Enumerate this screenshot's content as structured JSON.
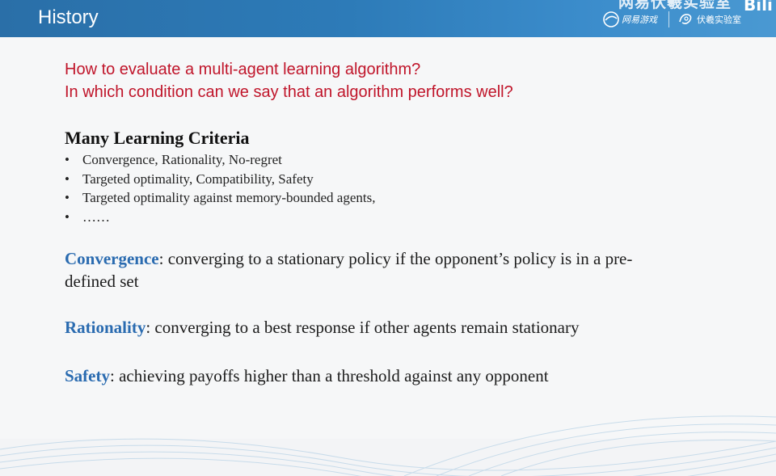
{
  "header": {
    "title": "History",
    "lab_name": "网易伏羲实验室",
    "logo_netease": "网易游戏",
    "logo_fuxi": "伏羲实验室",
    "watermark": "Bili"
  },
  "slide": {
    "questions": [
      "How to evaluate a multi-agent learning algorithm?",
      "In which condition can we say that an algorithm performs well?"
    ],
    "criteria_title": "Many Learning Criteria",
    "bullets": [
      "Convergence, Rationality, No-regret",
      "Targeted optimality, Compatibility, Safety",
      "Targeted optimality against memory-bounded agents,",
      "……"
    ],
    "bullet_symbol": "•",
    "definitions": [
      {
        "term": "Convergence",
        "text": ": converging to a stationary policy if the opponent’s policy is in a pre-defined set"
      },
      {
        "term": "Rationality",
        "text": ": converging to a best response if other agents remain stationary"
      },
      {
        "term": "Safety",
        "text": ": achieving payoffs higher than a threshold against any opponent"
      }
    ]
  },
  "colors": {
    "header_bg": "#2d7bb8",
    "question_red": "#c0152a",
    "term_blue": "#2a6bb0"
  }
}
